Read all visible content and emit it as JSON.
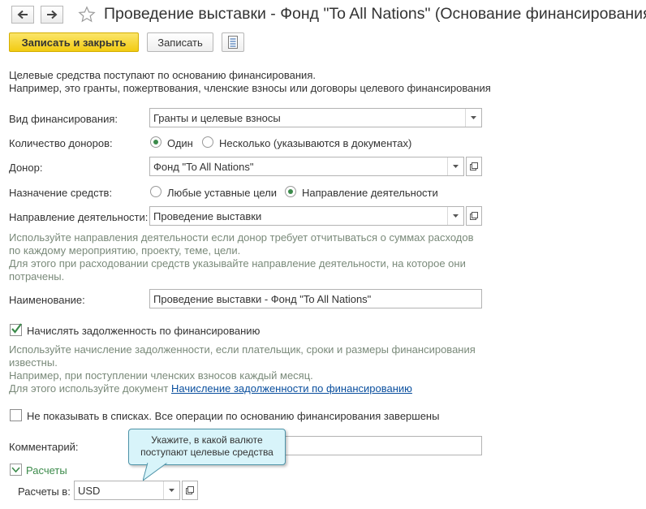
{
  "window": {
    "title": "Проведение выставки - Фонд \"To All Nations\" (Основание финансирования)"
  },
  "toolbar": {
    "save_close_label": "Записать и закрыть",
    "save_label": "Записать"
  },
  "intro": {
    "line1": "Целевые средства поступают по основанию финансирования.",
    "line2": "Например, это гранты, пожертвования, членские взносы или договоры целевого финансирования"
  },
  "form": {
    "financing_type": {
      "label": "Вид финансирования:",
      "value": "Гранты и целевые взносы"
    },
    "donor_count": {
      "label": "Количество доноров:",
      "option_one": "Один",
      "option_several": "Несколько (указываются в документах)",
      "selected": "one"
    },
    "donor": {
      "label": "Донор:",
      "value": "Фонд \"To All Nations\""
    },
    "purpose": {
      "label": "Назначение средств:",
      "option_any": "Любые уставные цели",
      "option_direction": "Направление деятельности",
      "selected": "direction"
    },
    "direction": {
      "label": "Направление деятельности:",
      "value": "Проведение выставки"
    },
    "direction_hint": {
      "line1": "Используйте направления деятельности если донор требует отчитываться о суммах расходов",
      "line2": "по каждому мероприятию, проекту, теме, цели.",
      "line3": "Для этого при расходовании средств указывайте направление деятельности, на которое они",
      "line4": "потрачены."
    },
    "name": {
      "label": "Наименование:",
      "value": "Проведение выставки - Фонд \"To All Nations\""
    },
    "accrue_debt": {
      "label": "Начислять задолженность по финансированию",
      "checked": true
    },
    "accrue_hint": {
      "line1": "Используйте начисление задолженности, если плательщик, сроки и размеры финансирования",
      "line2": "известны.",
      "line3": "Например, при поступлении членских взносов каждый месяц.",
      "line4_prefix": "Для этого используйте документ ",
      "line4_link": "Начисление задолженности по финансированию"
    },
    "hide_in_lists": {
      "label": "Не показывать в списках. Все операции по основанию финансирования завершены",
      "checked": false
    },
    "comment": {
      "label": "Комментарий:",
      "value": ""
    }
  },
  "settlements": {
    "group_label": "Расчеты",
    "expanded": true,
    "currency_label": "Расчеты в:",
    "currency_value": "USD"
  },
  "tooltip": {
    "line1": "Укажите, в какой валюте",
    "line2": "поступают целевые средства"
  },
  "colors": {
    "primary_button": "#f2cb12",
    "hint_text": "#7a8a7a",
    "accent_green": "#3c8b4b",
    "link": "#0a4f9e",
    "tooltip_bg": "#d8f4fa"
  }
}
